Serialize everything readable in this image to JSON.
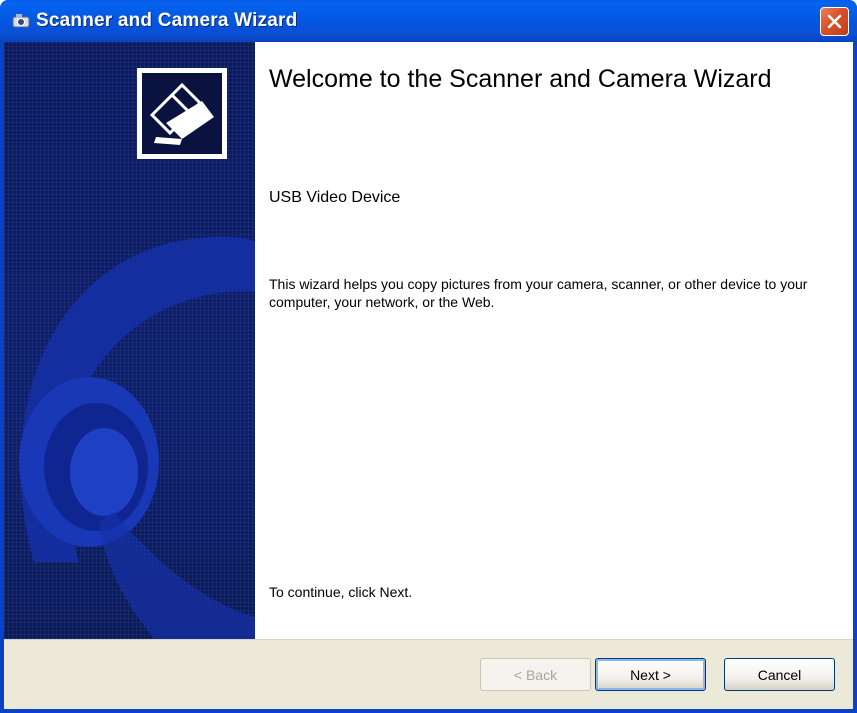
{
  "window": {
    "title": "Scanner and Camera Wizard",
    "title_icon": "scanner-camera-icon",
    "close_icon": "close-icon"
  },
  "content": {
    "heading": "Welcome to the Scanner and Camera Wizard",
    "device_name": "USB Video Device",
    "description": "This wizard helps you copy pictures from your camera, scanner, or other device to your computer, your network, or the Web.",
    "continue_text": "To continue, click Next."
  },
  "buttons": {
    "back_label": "< Back",
    "next_label": "Next >",
    "cancel_label": "Cancel"
  },
  "colors": {
    "titlebar": "#0358e3",
    "side_panel": "#0d1e6a",
    "button_area": "#ece9d8",
    "close_button": "#d9502b"
  }
}
